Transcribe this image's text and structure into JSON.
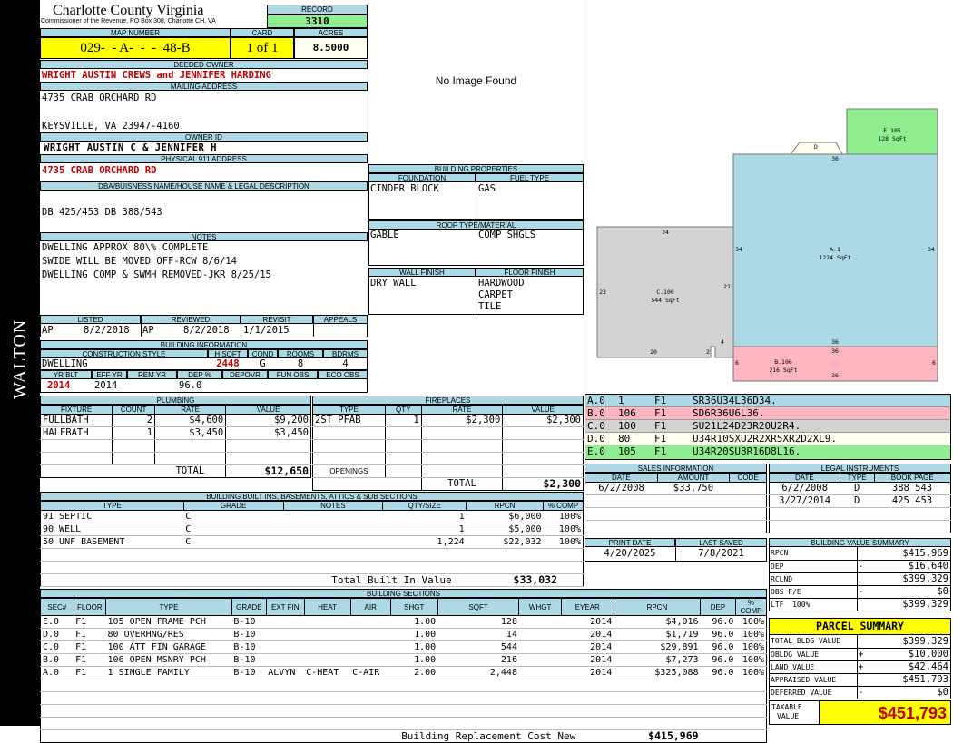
{
  "side_label": "WALTON",
  "county": {
    "title": "Charlotte County Virginia",
    "subtitle": "Commissioner of the Revenue, PO Box 308, Charlotte CH, VA"
  },
  "record": {
    "header": "RECORD",
    "value": "3310"
  },
  "map": {
    "header": "MAP NUMBER",
    "value": "029-  - A-  -  -  48-B"
  },
  "card": {
    "header": "CARD",
    "value": "1 of 1"
  },
  "acres": {
    "header": "ACRES",
    "value": "8.5000"
  },
  "deeded": {
    "header": "DEEDED OWNER",
    "value": "WRIGHT AUSTIN CREWS and JENNIFER HARDING"
  },
  "mailing": {
    "header": "MAILING ADDRESS",
    "line1": "4735 CRAB ORCHARD RD",
    "line2": "KEYSVILLE, VA 23947-4160"
  },
  "owner_id": {
    "header": "OWNER ID",
    "value": "WRIGHT AUSTIN C & JENNIFER H"
  },
  "physical": {
    "header": "PHYSICAL 911 ADDRESS",
    "value": "4735 CRAB ORCHARD RD"
  },
  "legal_desc": {
    "header": "DBA/BUISNESS NAME/HOUSE NAME & LEGAL DESCRIPTION",
    "value": "DB 425/453 DB 388/543"
  },
  "notes": {
    "header": "NOTES",
    "lines": [
      "DWELLING APPROX 80\\% COMPLETE",
      "SWIDE WILL BE MOVED OFF-RCW 8/6/14",
      "DWELLING COMP & SWMH REMOVED-JKR 8/25/15"
    ]
  },
  "review": {
    "listed_h": "LISTED",
    "reviewed_h": "REVIEWED",
    "revisit_h": "REVISIT",
    "appeals_h": "APPEALS",
    "listed_by": "AP",
    "listed_date": "8/2/2018",
    "reviewed_by": "AP",
    "reviewed_date": "8/2/2018",
    "revisit": "1/1/2015"
  },
  "bldg_info": {
    "header": "BUILDING INFORMATION",
    "cs_h": "CONSTRUCTION STYLE",
    "hsqft_h": "H SQFT",
    "cond_h": "COND",
    "rooms_h": "ROOMS",
    "bdrms_h": "BDRMS",
    "style": "DWELLING",
    "hsqft": "2448",
    "cond": "G",
    "rooms": "8",
    "bdrms": "4",
    "yrblt_h": "YR BLT",
    "effyr_h": "EFF YR",
    "remyr_h": "REM YR",
    "dep_h": "DEP %",
    "depovr_h": "DEPOVR",
    "funobs_h": "FUN OBS",
    "ecoobs_h": "ECO OBS",
    "yrblt": "2014",
    "effyr": "2014",
    "dep": "96.0"
  },
  "image": {
    "text": "No Image Found"
  },
  "bprops": {
    "header": "BUILDING PROPERTIES",
    "foundation_h": "FOUNDATION",
    "fuel_h": "FUEL TYPE",
    "foundation": "CINDER BLOCK",
    "fuel": "GAS",
    "roof_h": "ROOF TYPE/MATERIAL",
    "roof_type": "GABLE",
    "roof_mat": "COMP SHGLS",
    "wall_h": "WALL FINISH",
    "floor_h": "FLOOR FINISH",
    "wall": "DRY WALL",
    "floors": [
      "HARDWOOD",
      "CARPET",
      "TILE"
    ]
  },
  "sketch": {
    "e": {
      "label": "E.105",
      "area": "128 SqFt"
    },
    "d": {
      "label": "D"
    },
    "a": {
      "label": "A.1",
      "area": "1224 SqFt"
    },
    "c": {
      "label": "C.100",
      "area": "544 SqFt"
    },
    "b": {
      "label": "B.106",
      "area": "216 SqFt"
    },
    "dims": {
      "a_top": "36",
      "a_left": "34",
      "a_right": "34",
      "a_bot": "36",
      "c_top": "24",
      "c_left": "23",
      "c_right": "21",
      "c_bot1": "20",
      "c_bot2": "2",
      "c_4": "4",
      "b_top": "36",
      "b_left": "6",
      "b_right": "6",
      "b_bot": "36"
    }
  },
  "sketch_codes": [
    {
      "id": "A.0",
      "n": "1",
      "fl": "F1",
      "code": "SR36U34L36D34.",
      "bg": "#add8e6"
    },
    {
      "id": "B.0",
      "n": "106",
      "fl": "F1",
      "code": "SD6R36U6L36.",
      "bg": "#ffb6c1"
    },
    {
      "id": "C.0",
      "n": "100",
      "fl": "F1",
      "code": "SU21L24D23R20U2R4.",
      "bg": "#d3d3d3"
    },
    {
      "id": "D.0",
      "n": "80",
      "fl": "F1",
      "code": "U34R10SXU2R2XR5XR2D2XL9.",
      "bg": "#fffff0"
    },
    {
      "id": "E.0",
      "n": "105",
      "fl": "F1",
      "code": "U34R20SU8R16D8L16.",
      "bg": "#90ee90"
    }
  ],
  "plumbing": {
    "header": "PLUMBING",
    "cols": [
      "FIXTURE",
      "COUNT",
      "RATE",
      "VALUE"
    ],
    "rows": [
      [
        "FULLBATH",
        "2",
        "$4,600",
        "$9,200"
      ],
      [
        "HALFBATH",
        "1",
        "$3,450",
        "$3,450"
      ]
    ],
    "total_label": "TOTAL",
    "total": "$12,650"
  },
  "fireplaces": {
    "header": "FIREPLACES",
    "cols": [
      "TYPE",
      "QTY",
      "RATE",
      "VALUE"
    ],
    "rows": [
      [
        "2ST PFAB",
        "1",
        "$2,300",
        "$2,300"
      ]
    ],
    "openings_label": "OPENINGS",
    "total_label": "TOTAL",
    "total": "$2,300"
  },
  "sales": {
    "header": "SALES INFORMATION",
    "cols": [
      "DATE",
      "AMOUNT",
      "CODE"
    ],
    "rows": [
      [
        "6/2/2008",
        "$33,750",
        ""
      ]
    ]
  },
  "legal": {
    "header": "LEGAL INSTRUMENTS",
    "cols": [
      "DATE",
      "TYPE",
      "BOOK PAGE"
    ],
    "rows": [
      [
        "6/2/2008",
        "D",
        "388 543"
      ],
      [
        "3/27/2014",
        "D",
        "425 453"
      ]
    ]
  },
  "builtins": {
    "header": "BUILDING BUILT INS, BASEMENTS, ATTICS & SUB SECTIONS",
    "cols": [
      "TYPE",
      "GRADE",
      "NOTES",
      "QTY/SIZE",
      "RPCN",
      "% COMP"
    ],
    "rows": [
      [
        "91 SEPTIC",
        "C",
        "",
        "1",
        "$6,000",
        "100%"
      ],
      [
        "90 WELL",
        "C",
        "",
        "1",
        "$5,000",
        "100%"
      ],
      [
        "50 UNF BASEMENT",
        "C",
        "",
        "1,224",
        "$22,032",
        "100%"
      ]
    ],
    "total_label": "Total Built In Value",
    "total": "$33,032"
  },
  "print": {
    "print_h": "PRINT DATE",
    "saved_h": "LAST SAVED",
    "print": "4/20/2025",
    "saved": "7/8/2021"
  },
  "bvs": {
    "header": "BUILDING VALUE SUMMARY",
    "rows": [
      [
        "RPCN",
        "",
        "$415,969"
      ],
      [
        "DEP",
        "-",
        "$16,640"
      ],
      [
        "RCLND",
        "",
        "$399,329"
      ],
      [
        "OBS F/E",
        "-",
        "$0"
      ],
      [
        "LTF  100%",
        "",
        "$399,329"
      ]
    ]
  },
  "sections": {
    "header": "BUILDING SECTIONS",
    "cols": [
      "SEC#",
      "FLOOR",
      "TYPE",
      "GRADE",
      "EXT FIN",
      "HEAT",
      "AIR",
      "SHGT",
      "SQFT",
      "WHGT",
      "EYEAR",
      "RPCN",
      "DEP",
      "% COMP"
    ],
    "rows": [
      [
        "E.0",
        "F1",
        "105 OPEN FRAME PCH",
        "B-10",
        "",
        "",
        "",
        "1.00",
        "128",
        "",
        "2014",
        "$4,016",
        "96.0",
        "100%"
      ],
      [
        "D.0",
        "F1",
        "80 OVERHNG/RES",
        "B-10",
        "",
        "",
        "",
        "1.00",
        "14",
        "",
        "2014",
        "$1,719",
        "96.0",
        "100%"
      ],
      [
        "C.0",
        "F1",
        "100 ATT FIN GARAGE",
        "B-10",
        "",
        "",
        "",
        "1.00",
        "544",
        "",
        "2014",
        "$29,891",
        "96.0",
        "100%"
      ],
      [
        "B.0",
        "F1",
        "106 OPEN MSNRY PCH",
        "B-10",
        "",
        "",
        "",
        "1.00",
        "216",
        "",
        "2014",
        "$7,273",
        "96.0",
        "100%"
      ],
      [
        "A.0",
        "F1",
        "1 SINGLE FAMILY",
        "B-10",
        "ALVYN",
        "C-HEAT",
        "C-AIR",
        "2.00",
        "2,448",
        "",
        "2014",
        "$325,088",
        "96.0",
        "100%"
      ]
    ],
    "total_label": "Building Replacement Cost New",
    "total": "$415,969"
  },
  "parcel": {
    "header": "PARCEL SUMMARY",
    "rows": [
      [
        "TOTAL BLDG VALUE",
        "",
        "$399,329"
      ],
      [
        "OBLDG VALUE",
        "+",
        "$10,000"
      ],
      [
        "LAND VALUE",
        "+",
        "$42,464"
      ],
      [
        "APPRAISED VALUE",
        "",
        "$451,793"
      ],
      [
        "DEFERRED VALUE",
        "-",
        "$0"
      ]
    ],
    "taxable_label1": "TAXABLE",
    "taxable_label2": "VALUE",
    "taxable": "$451,793"
  }
}
